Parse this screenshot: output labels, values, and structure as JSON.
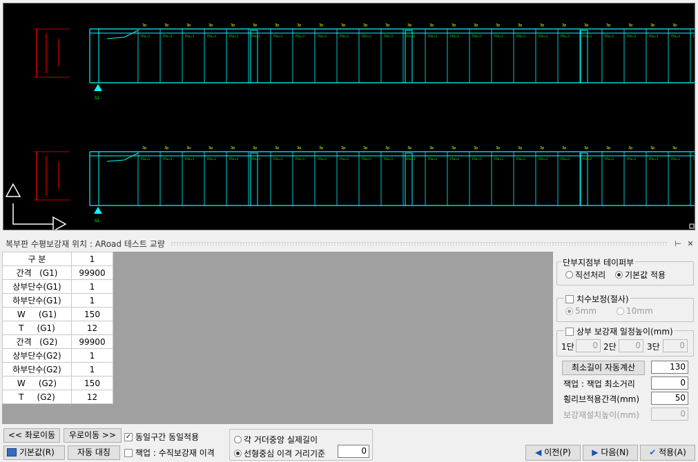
{
  "panel": {
    "title": "복부판 수평보강재 위치 : ARoad 테스트 교량",
    "pin_icon": "pin-icon",
    "close_icon": "close-icon",
    "pin_glyph": "⊢",
    "close_glyph": "✕"
  },
  "grid": {
    "header_label": "구 분",
    "column": "1",
    "rows": [
      {
        "label": "간격   (G1)",
        "value": "99900"
      },
      {
        "label": "상부단수(G1)",
        "value": "1"
      },
      {
        "label": "하부단수(G1)",
        "value": "1"
      },
      {
        "label": "W     (G1)",
        "value": "150"
      },
      {
        "label": "T     (G1)",
        "value": "12"
      },
      {
        "label": "간격   (G2)",
        "value": "99900"
      },
      {
        "label": "상부단수(G2)",
        "value": "1"
      },
      {
        "label": "하부단수(G2)",
        "value": "1"
      },
      {
        "label": "W     (G2)",
        "value": "150"
      },
      {
        "label": "T     (G2)",
        "value": "12"
      }
    ]
  },
  "taper": {
    "title": "단부지점부 테이퍼부",
    "opt1": "직선처리",
    "opt2": "기본값 적용",
    "selected": "opt2"
  },
  "dim_correction": {
    "title": "치수보정(절사)",
    "checked": false,
    "opt1": "5mm",
    "opt2": "10mm",
    "selected": "opt1"
  },
  "upper_height": {
    "title": "상부 보강재 일정높이(mm)",
    "checked": false,
    "l1": "1단",
    "v1": "0",
    "l2": "2단",
    "v2": "0",
    "l3": "3단",
    "v3": "0"
  },
  "auto_calc": {
    "button": "최소길이 자동계산",
    "value": "130"
  },
  "fields": {
    "wrap_label": "잭업 : 잭업 최소거리",
    "wrap_value": "0",
    "rib_label": "횡리브적용간격(mm)",
    "rib_value": "50",
    "height_label": "보강재설치높이(mm)",
    "height_value": "0"
  },
  "bottom": {
    "move_left": "<< 좌로이동",
    "move_right": "우로이동 >>",
    "same_section": "동일구간 동일적용",
    "same_section_checked": true,
    "default_btn": "기본값(R)",
    "auto_sym": "자동 대칭",
    "jackup": "잭업 : 수직보강재 이격",
    "jackup_checked": false,
    "radio1": "각 거더중앙 실제길이",
    "radio2": "선형중심 이격 거리기준",
    "radio_selected": "radio2",
    "offset_value": "0",
    "prev": "이전(P)",
    "next": "다음(N)",
    "apply": "적용(A)"
  },
  "colors": {
    "cad_bg": "#000000",
    "girder": "#00ffff",
    "dim": "#ff0000",
    "text": "#00ff00",
    "label": "#ffff00"
  }
}
